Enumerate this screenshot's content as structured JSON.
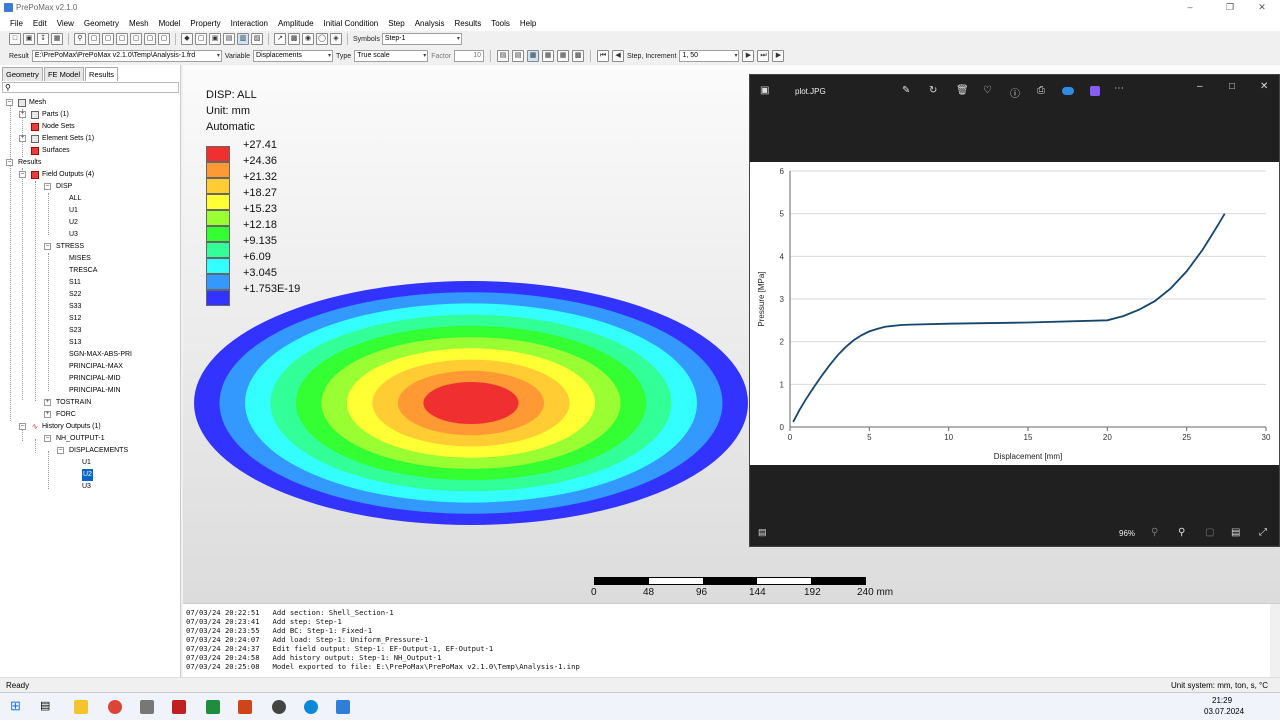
{
  "window": {
    "title": "PrePoMax v2.1.0"
  },
  "menu": [
    "File",
    "Edit",
    "View",
    "Geometry",
    "Mesh",
    "Model",
    "Property",
    "Interaction",
    "Amplitude",
    "Initial Condition",
    "Step",
    "Analysis",
    "Results",
    "Tools",
    "Help"
  ],
  "toolbar1": {
    "symbols_label": "Symbols",
    "step_value": "Step-1"
  },
  "toolbar2": {
    "result_label": "Result",
    "result_path": "E:\\PrePoMax\\PrePoMax v2.1.0\\Temp\\Analysis-1.frd",
    "variable_label": "Variable",
    "variable_value": "Displacements",
    "type_label": "Type",
    "type_value": "True scale",
    "factor_label": "Factor",
    "factor_value": "10",
    "step_inc_label": "Step, Increment",
    "step_inc_value": "1, 50"
  },
  "tabs": [
    "Geometry",
    "FE Model",
    "Results"
  ],
  "tree": {
    "mesh": "Mesh",
    "parts": "Parts (1)",
    "node_sets": "Node Sets",
    "element_sets": "Element Sets (1)",
    "surfaces": "Surfaces",
    "results": "Results",
    "field_outputs": "Field Outputs (4)",
    "disp": "DISP",
    "all": "ALL",
    "u1": "U1",
    "u2": "U2",
    "u3": "U3",
    "stress": "STRESS",
    "mises": "MISES",
    "tresca": "TRESCA",
    "s11": "S11",
    "s22": "S22",
    "s33": "S33",
    "s12": "S12",
    "s23": "S23",
    "s13": "S13",
    "sgn": "SGN-MAX-ABS-PRI",
    "pmax": "PRINCIPAL-MAX",
    "pmid": "PRINCIPAL-MID",
    "pmin": "PRINCIPAL-MIN",
    "tostrain": "TOSTRAIN",
    "forc": "FORC",
    "history_outputs": "History Outputs (1)",
    "nh_output": "NH_OUTPUT-1",
    "displacements": "DISPLACEMENTS",
    "hu1": "U1",
    "hu2": "U2",
    "hu3": "U3"
  },
  "legend": {
    "line1": "DISP: ALL",
    "line2": "Unit: mm",
    "line3": "Automatic",
    "values": [
      "+27.41",
      "+24.36",
      "+21.32",
      "+18.27",
      "+15.23",
      "+12.18",
      "+9.135",
      "+6.09",
      "+3.045",
      "+1.753E-19"
    ],
    "colors": [
      "#f03030",
      "#ff9933",
      "#ffcc33",
      "#ffff33",
      "#99ff33",
      "#33ff33",
      "#33ff99",
      "#33ffff",
      "#3399ff",
      "#3333ff"
    ]
  },
  "contour_colors": [
    "#3333ff",
    "#3399ff",
    "#33ffff",
    "#33ff99",
    "#33ff33",
    "#99ff33",
    "#ffff33",
    "#ffcc33",
    "#ff9933",
    "#f03030"
  ],
  "scalebar": {
    "labels": [
      "0",
      "48",
      "96",
      "144",
      "192",
      "240 mm"
    ]
  },
  "log": [
    "07/03/24 20:22:51   Add section: Shell_Section-1",
    "07/03/24 20:23:41   Add step: Step-1",
    "07/03/24 20:23:55   Add BC: Step-1: Fixed-1",
    "07/03/24 20:24:07   Add load: Step-1: Uniform_Pressure-1",
    "07/03/24 20:24:37   Edit field output: Step-1: EF-Output-1, EF-Output-1",
    "07/03/24 20:24:58   Add history output: Step-1: NH_Output-1",
    "07/03/24 20:25:08   Model exported to file: E:\\PrePoMax\\PrePoMax v2.1.0\\Temp\\Analysis-1.inp"
  ],
  "status": {
    "left": "Ready",
    "right": "Unit system: mm, ton, s, °C"
  },
  "photo": {
    "filename": "plot.JPG",
    "zoom": "96%"
  },
  "chart_data": {
    "type": "line",
    "xlabel": "Displacement [mm]",
    "ylabel": "Pressure [MPa]",
    "xlim": [
      0,
      30
    ],
    "ylim": [
      0,
      6
    ],
    "xticks": [
      "0",
      "5",
      "10",
      "15",
      "20",
      "25",
      "30"
    ],
    "yticks": [
      "0",
      "1",
      "2",
      "3",
      "4",
      "5",
      "6"
    ],
    "grid": "horizontal",
    "series": [
      {
        "x": [
          0.2,
          0.6,
          1,
          1.5,
          2,
          2.5,
          3,
          3.5,
          4,
          4.5,
          5,
          5.5,
          6,
          7,
          7.6,
          10,
          15,
          20,
          21,
          22,
          23,
          24,
          25,
          26,
          26.5,
          27,
          27.4
        ],
        "y": [
          0.12,
          0.4,
          0.65,
          0.93,
          1.2,
          1.45,
          1.68,
          1.87,
          2.03,
          2.15,
          2.24,
          2.3,
          2.35,
          2.39,
          2.4,
          2.42,
          2.45,
          2.5,
          2.6,
          2.75,
          2.95,
          3.25,
          3.65,
          4.15,
          4.45,
          4.75,
          5.0
        ]
      }
    ],
    "color": "#15456a"
  },
  "clock": {
    "time": "21:29",
    "date": "03.07.2024"
  }
}
